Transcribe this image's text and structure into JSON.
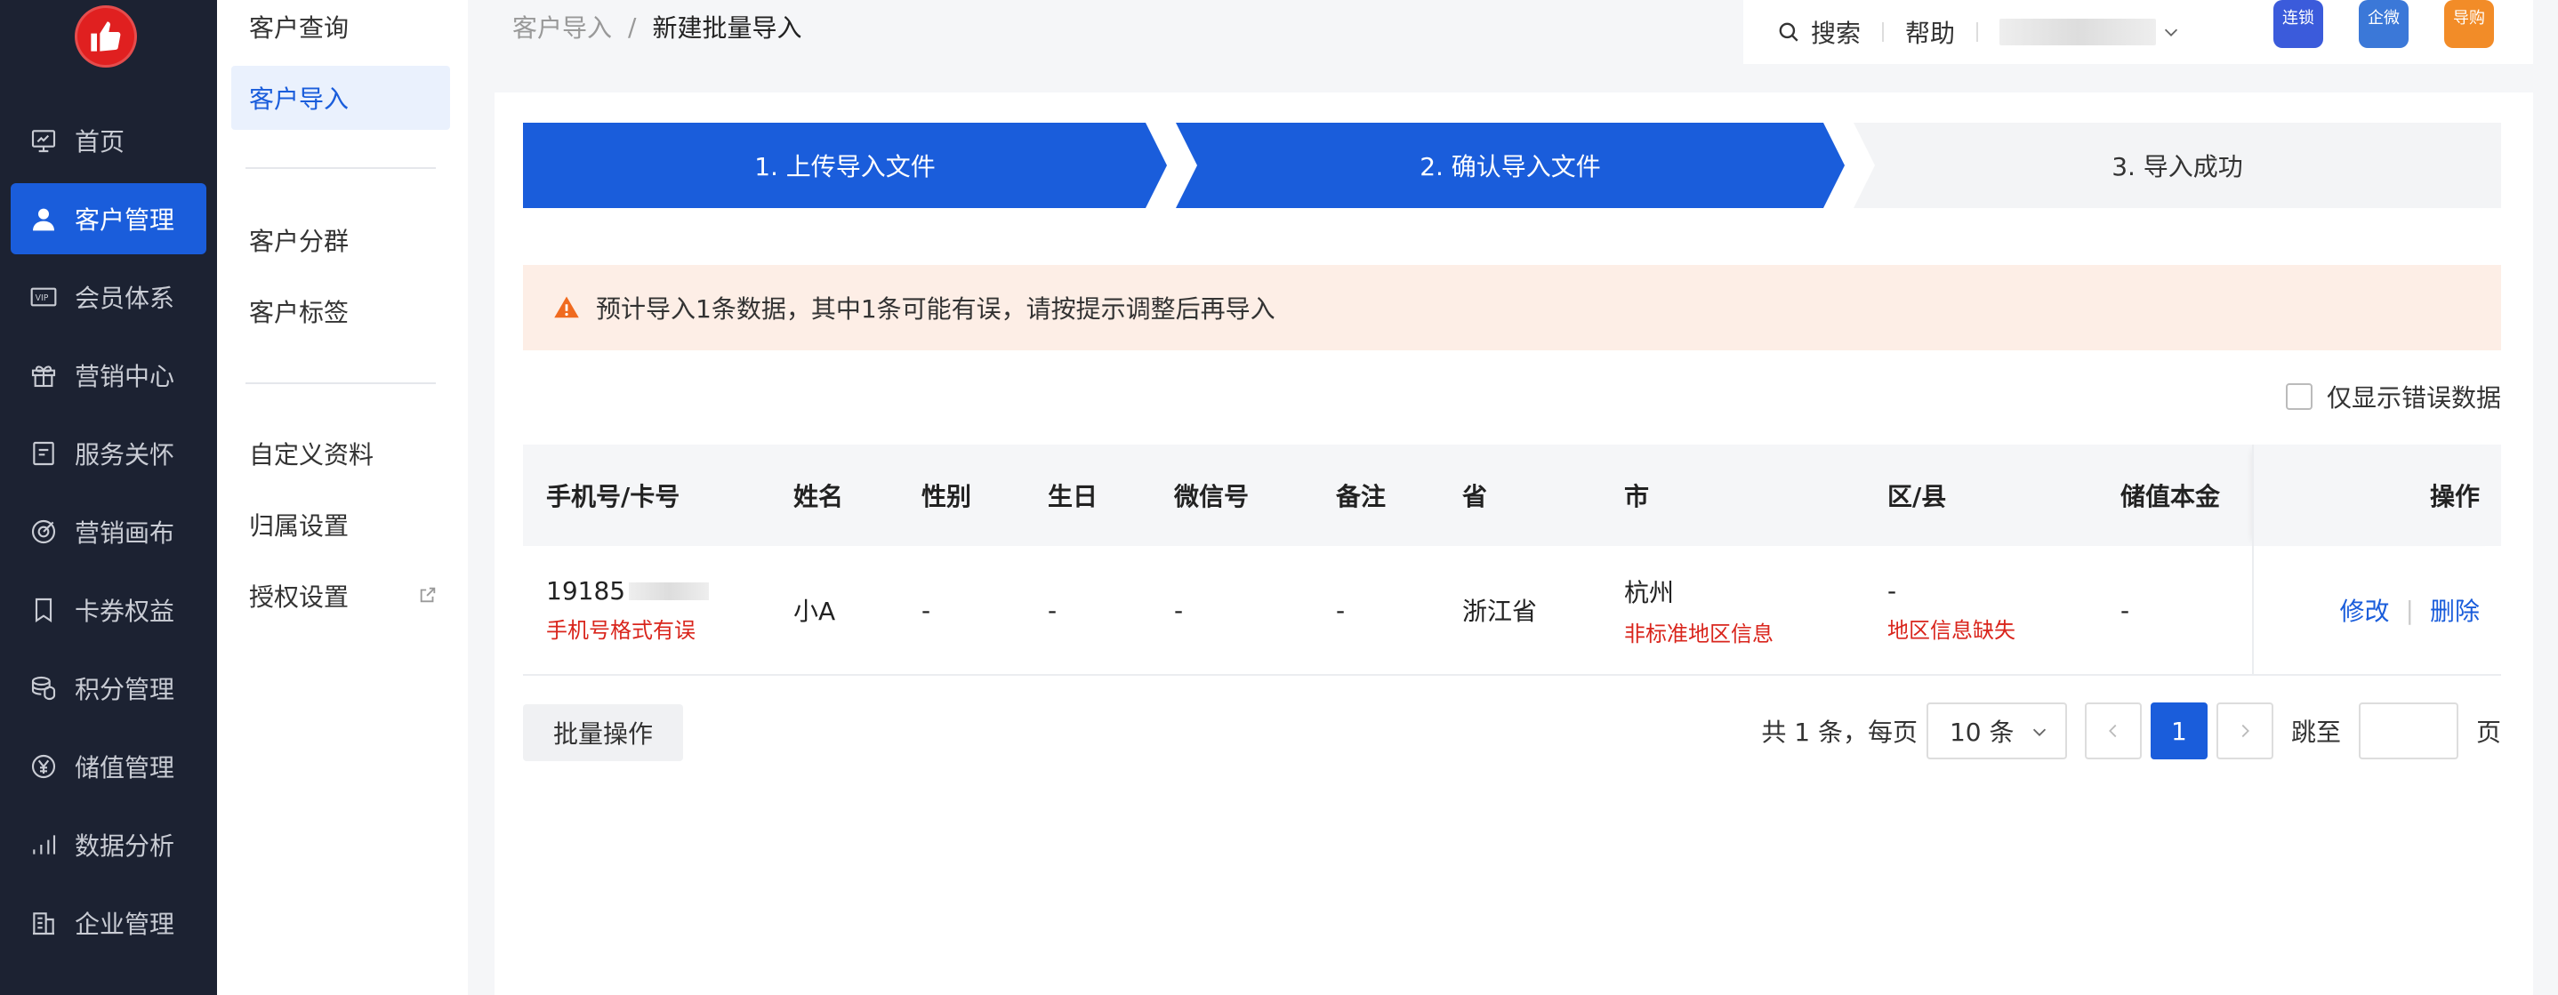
{
  "sidebar": {
    "items": [
      {
        "label": "首页",
        "icon": "monitor-icon"
      },
      {
        "label": "客户管理",
        "icon": "user-icon"
      },
      {
        "label": "会员体系",
        "icon": "vip-icon"
      },
      {
        "label": "营销中心",
        "icon": "gift-icon"
      },
      {
        "label": "服务关怀",
        "icon": "message-icon"
      },
      {
        "label": "营销画布",
        "icon": "target-icon"
      },
      {
        "label": "卡券权益",
        "icon": "bookmark-icon"
      },
      {
        "label": "积分管理",
        "icon": "coins-icon"
      },
      {
        "label": "储值管理",
        "icon": "yen-icon"
      },
      {
        "label": "数据分析",
        "icon": "bar-chart-icon"
      },
      {
        "label": "企业管理",
        "icon": "building-icon"
      }
    ],
    "active_index": 1
  },
  "subnav": {
    "items": [
      "客户查询",
      "客户导入",
      "客户分群",
      "客户标签",
      "自定义资料",
      "归属设置",
      "授权设置"
    ],
    "active_index": 1
  },
  "breadcrumb": {
    "parent": "客户导入",
    "separator": "/",
    "current": "新建批量导入"
  },
  "topbar": {
    "search": "搜索",
    "help": "帮助",
    "apps": [
      {
        "label": "连锁",
        "color": "#3b5bdb"
      },
      {
        "label": "企微",
        "color": "#3b78d8"
      },
      {
        "label": "导购",
        "color": "#f28c28"
      }
    ]
  },
  "steps": [
    "1. 上传导入文件",
    "2. 确认导入文件",
    "3. 导入成功"
  ],
  "alert": {
    "text": "预计导入1条数据，其中1条可能有误，请按提示调整后再导入"
  },
  "filter": {
    "only_errors_label": "仅显示错误数据",
    "checked": false
  },
  "table": {
    "headers": [
      "手机号/卡号",
      "姓名",
      "性别",
      "生日",
      "微信号",
      "备注",
      "省",
      "市",
      "区/县",
      "储值本金",
      "操作"
    ],
    "rows": [
      {
        "phone": "19185",
        "phone_error": "手机号格式有误",
        "name": "小A",
        "gender": "-",
        "birthday": "-",
        "wechat": "-",
        "remark": "-",
        "province": "浙江省",
        "city": "杭州",
        "city_error": "非标准地区信息",
        "district": "-",
        "district_error": "地区信息缺失",
        "balance": "-",
        "edit": "修改",
        "delete": "删除"
      }
    ]
  },
  "footer": {
    "batch_label": "批量操作",
    "total": "共 1 条，每页",
    "page_size": "10 条",
    "current_page": "1",
    "jump_label": "跳至",
    "page_unit": "页"
  }
}
